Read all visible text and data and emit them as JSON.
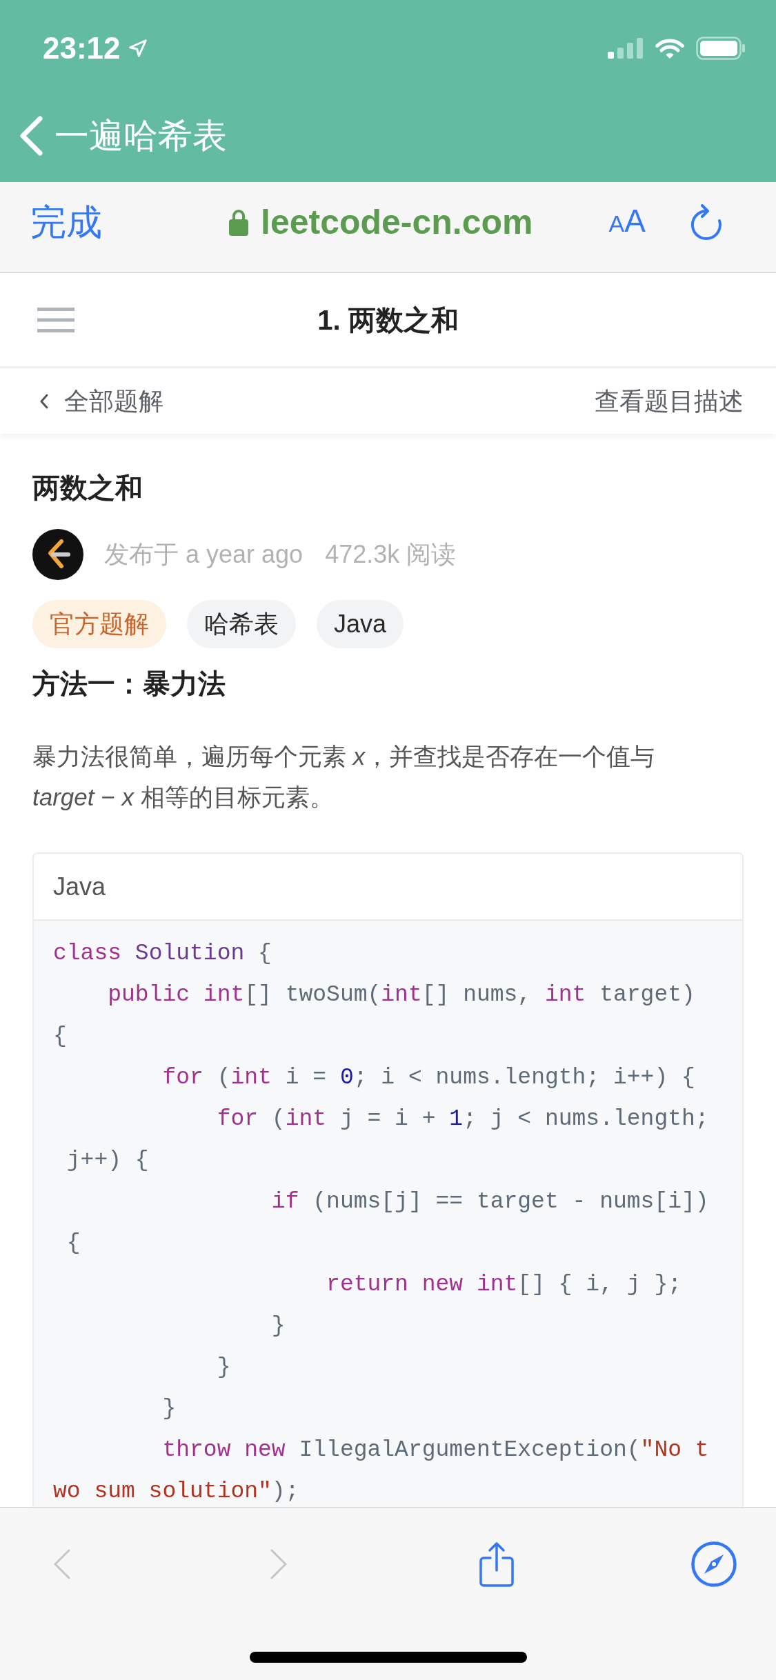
{
  "status_bar": {
    "time": "23:12"
  },
  "nav_bar": {
    "back_title": "一遍哈希表"
  },
  "browser_bar": {
    "done": "完成",
    "url": "leetcode-cn.com",
    "text_size": "AA"
  },
  "page_header": {
    "title": "1. 两数之和"
  },
  "sub_nav": {
    "back_link": "全部题解",
    "description_link": "查看题目描述"
  },
  "article": {
    "title": "两数之和",
    "published": "发布于 a year ago",
    "reads": "472.3k 阅读",
    "tags": [
      {
        "label": "官方题解",
        "kind": "official"
      },
      {
        "label": "哈希表",
        "kind": "topic"
      },
      {
        "label": "Java",
        "kind": "topic"
      }
    ],
    "heading": "方法一：暴力法",
    "paragraph": "暴力法很简单，遍历每个元素 *x*，并查找是否存在一个值与 *target* − *x* 相等的目标元素。",
    "code_block": {
      "language": "Java",
      "lines": [
        {
          "tokens": [
            {
              "kind": "keyword",
              "text": "class "
            },
            {
              "kind": "class_name",
              "text": "Solution"
            },
            {
              "kind": "plain",
              "text": " {"
            }
          ]
        },
        {
          "tokens": [
            {
              "kind": "keyword",
              "text": "    public "
            },
            {
              "kind": "keyword",
              "text": "int"
            },
            {
              "kind": "plain",
              "text": "[] twoSum("
            },
            {
              "kind": "keyword",
              "text": "int"
            },
            {
              "kind": "plain",
              "text": "[] nums, "
            },
            {
              "kind": "keyword",
              "text": "int"
            },
            {
              "kind": "plain",
              "text": " target)"
            }
          ]
        },
        {
          "tokens": [
            {
              "kind": "plain",
              "text": "{"
            }
          ]
        },
        {
          "tokens": [
            {
              "kind": "keyword",
              "text": "        for"
            },
            {
              "kind": "plain",
              "text": " ("
            },
            {
              "kind": "keyword",
              "text": "int"
            },
            {
              "kind": "plain",
              "text": " i = "
            },
            {
              "kind": "number",
              "text": "0"
            },
            {
              "kind": "plain",
              "text": "; i < nums.length; i++) {"
            }
          ]
        },
        {
          "tokens": [
            {
              "kind": "keyword",
              "text": "            for"
            },
            {
              "kind": "plain",
              "text": " ("
            },
            {
              "kind": "keyword",
              "text": "int"
            },
            {
              "kind": "plain",
              "text": " j = i + "
            },
            {
              "kind": "number",
              "text": "1"
            },
            {
              "kind": "plain",
              "text": "; j < nums.length;"
            }
          ]
        },
        {
          "tokens": [
            {
              "kind": "plain",
              "text": " j++) {"
            }
          ]
        },
        {
          "tokens": [
            {
              "kind": "keyword",
              "text": "                if"
            },
            {
              "kind": "plain",
              "text": " (nums[j] == target - nums[i])"
            }
          ]
        },
        {
          "tokens": [
            {
              "kind": "plain",
              "text": " {"
            }
          ]
        },
        {
          "tokens": [
            {
              "kind": "keyword",
              "text": "                    return "
            },
            {
              "kind": "keyword",
              "text": "new "
            },
            {
              "kind": "keyword",
              "text": "int"
            },
            {
              "kind": "plain",
              "text": "[] { i, j };"
            }
          ]
        },
        {
          "tokens": [
            {
              "kind": "plain",
              "text": "                }"
            }
          ]
        },
        {
          "tokens": [
            {
              "kind": "plain",
              "text": "            }"
            }
          ]
        },
        {
          "tokens": [
            {
              "kind": "plain",
              "text": "        }"
            }
          ]
        },
        {
          "tokens": [
            {
              "kind": "keyword",
              "text": "        throw "
            },
            {
              "kind": "keyword",
              "text": "new"
            },
            {
              "kind": "plain",
              "text": " IllegalArgumentException("
            },
            {
              "kind": "string",
              "text": "\"No t"
            }
          ]
        },
        {
          "tokens": [
            {
              "kind": "string",
              "text": "wo sum solution\""
            },
            {
              "kind": "plain",
              "text": ");"
            }
          ]
        }
      ]
    }
  },
  "bottom_toolbar": {
    "buttons": [
      {
        "kind": "back",
        "disabled": true
      },
      {
        "kind": "forward",
        "disabled": true
      },
      {
        "kind": "share",
        "disabled": false
      },
      {
        "kind": "compass",
        "disabled": false
      }
    ]
  }
}
